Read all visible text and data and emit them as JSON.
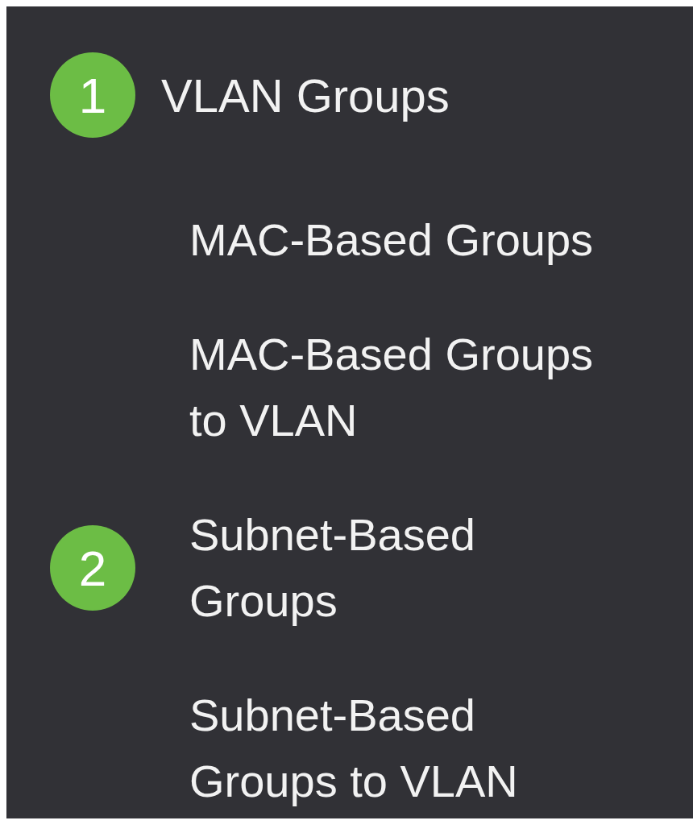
{
  "menu": {
    "label": "VLAN Groups",
    "badge": "1",
    "children": [
      {
        "label": "MAC-Based Groups"
      },
      {
        "label": "MAC-Based Groups to VLAN"
      },
      {
        "label": "Subnet-Based Groups",
        "badge": "2"
      },
      {
        "label": "Subnet-Based Groups to VLAN"
      }
    ]
  }
}
